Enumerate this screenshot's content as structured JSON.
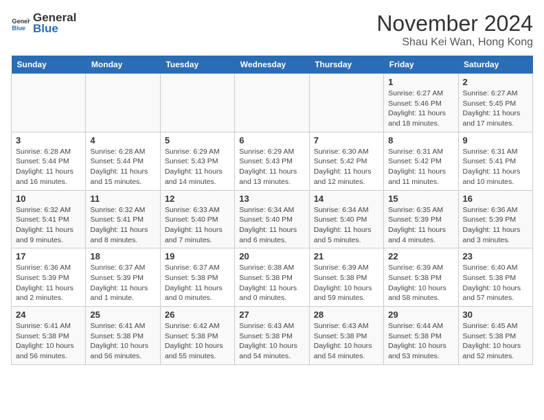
{
  "header": {
    "logo_line1": "General",
    "logo_line2": "Blue",
    "month_title": "November 2024",
    "subtitle": "Shau Kei Wan, Hong Kong"
  },
  "days_of_week": [
    "Sunday",
    "Monday",
    "Tuesday",
    "Wednesday",
    "Thursday",
    "Friday",
    "Saturday"
  ],
  "weeks": [
    [
      {
        "day": "",
        "info": ""
      },
      {
        "day": "",
        "info": ""
      },
      {
        "day": "",
        "info": ""
      },
      {
        "day": "",
        "info": ""
      },
      {
        "day": "",
        "info": ""
      },
      {
        "day": "1",
        "info": "Sunrise: 6:27 AM\nSunset: 5:46 PM\nDaylight: 11 hours and 18 minutes."
      },
      {
        "day": "2",
        "info": "Sunrise: 6:27 AM\nSunset: 5:45 PM\nDaylight: 11 hours and 17 minutes."
      }
    ],
    [
      {
        "day": "3",
        "info": "Sunrise: 6:28 AM\nSunset: 5:44 PM\nDaylight: 11 hours and 16 minutes."
      },
      {
        "day": "4",
        "info": "Sunrise: 6:28 AM\nSunset: 5:44 PM\nDaylight: 11 hours and 15 minutes."
      },
      {
        "day": "5",
        "info": "Sunrise: 6:29 AM\nSunset: 5:43 PM\nDaylight: 11 hours and 14 minutes."
      },
      {
        "day": "6",
        "info": "Sunrise: 6:29 AM\nSunset: 5:43 PM\nDaylight: 11 hours and 13 minutes."
      },
      {
        "day": "7",
        "info": "Sunrise: 6:30 AM\nSunset: 5:42 PM\nDaylight: 11 hours and 12 minutes."
      },
      {
        "day": "8",
        "info": "Sunrise: 6:31 AM\nSunset: 5:42 PM\nDaylight: 11 hours and 11 minutes."
      },
      {
        "day": "9",
        "info": "Sunrise: 6:31 AM\nSunset: 5:41 PM\nDaylight: 11 hours and 10 minutes."
      }
    ],
    [
      {
        "day": "10",
        "info": "Sunrise: 6:32 AM\nSunset: 5:41 PM\nDaylight: 11 hours and 9 minutes."
      },
      {
        "day": "11",
        "info": "Sunrise: 6:32 AM\nSunset: 5:41 PM\nDaylight: 11 hours and 8 minutes."
      },
      {
        "day": "12",
        "info": "Sunrise: 6:33 AM\nSunset: 5:40 PM\nDaylight: 11 hours and 7 minutes."
      },
      {
        "day": "13",
        "info": "Sunrise: 6:34 AM\nSunset: 5:40 PM\nDaylight: 11 hours and 6 minutes."
      },
      {
        "day": "14",
        "info": "Sunrise: 6:34 AM\nSunset: 5:40 PM\nDaylight: 11 hours and 5 minutes."
      },
      {
        "day": "15",
        "info": "Sunrise: 6:35 AM\nSunset: 5:39 PM\nDaylight: 11 hours and 4 minutes."
      },
      {
        "day": "16",
        "info": "Sunrise: 6:36 AM\nSunset: 5:39 PM\nDaylight: 11 hours and 3 minutes."
      }
    ],
    [
      {
        "day": "17",
        "info": "Sunrise: 6:36 AM\nSunset: 5:39 PM\nDaylight: 11 hours and 2 minutes."
      },
      {
        "day": "18",
        "info": "Sunrise: 6:37 AM\nSunset: 5:39 PM\nDaylight: 11 hours and 1 minute."
      },
      {
        "day": "19",
        "info": "Sunrise: 6:37 AM\nSunset: 5:38 PM\nDaylight: 11 hours and 0 minutes."
      },
      {
        "day": "20",
        "info": "Sunrise: 6:38 AM\nSunset: 5:38 PM\nDaylight: 11 hours and 0 minutes."
      },
      {
        "day": "21",
        "info": "Sunrise: 6:39 AM\nSunset: 5:38 PM\nDaylight: 10 hours and 59 minutes."
      },
      {
        "day": "22",
        "info": "Sunrise: 6:39 AM\nSunset: 5:38 PM\nDaylight: 10 hours and 58 minutes."
      },
      {
        "day": "23",
        "info": "Sunrise: 6:40 AM\nSunset: 5:38 PM\nDaylight: 10 hours and 57 minutes."
      }
    ],
    [
      {
        "day": "24",
        "info": "Sunrise: 6:41 AM\nSunset: 5:38 PM\nDaylight: 10 hours and 56 minutes."
      },
      {
        "day": "25",
        "info": "Sunrise: 6:41 AM\nSunset: 5:38 PM\nDaylight: 10 hours and 56 minutes."
      },
      {
        "day": "26",
        "info": "Sunrise: 6:42 AM\nSunset: 5:38 PM\nDaylight: 10 hours and 55 minutes."
      },
      {
        "day": "27",
        "info": "Sunrise: 6:43 AM\nSunset: 5:38 PM\nDaylight: 10 hours and 54 minutes."
      },
      {
        "day": "28",
        "info": "Sunrise: 6:43 AM\nSunset: 5:38 PM\nDaylight: 10 hours and 54 minutes."
      },
      {
        "day": "29",
        "info": "Sunrise: 6:44 AM\nSunset: 5:38 PM\nDaylight: 10 hours and 53 minutes."
      },
      {
        "day": "30",
        "info": "Sunrise: 6:45 AM\nSunset: 5:38 PM\nDaylight: 10 hours and 52 minutes."
      }
    ]
  ]
}
